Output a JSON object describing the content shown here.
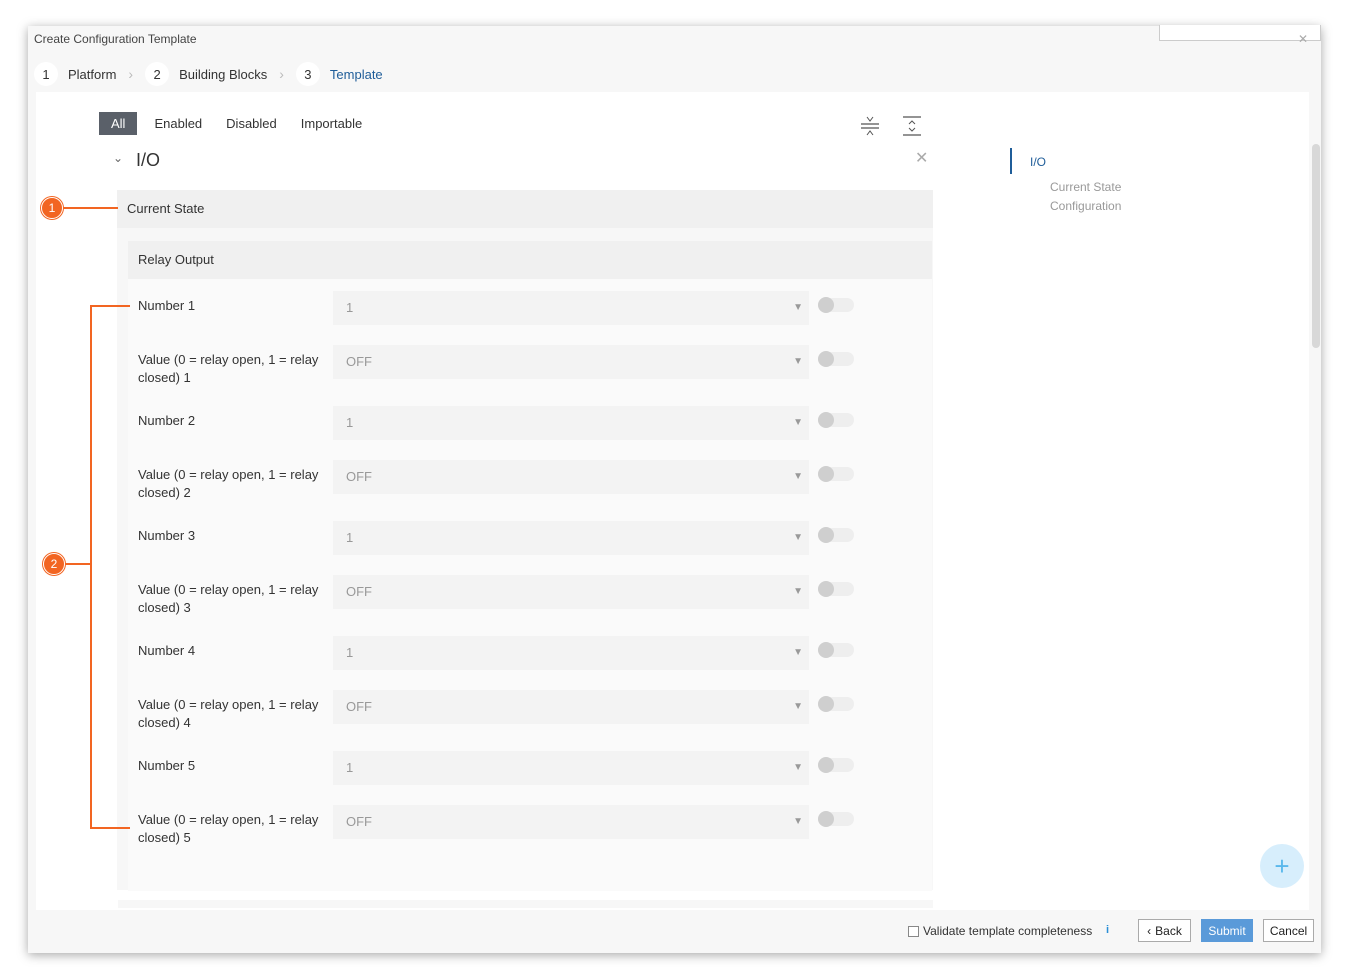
{
  "window": {
    "title": "Create Configuration Template"
  },
  "steps": [
    {
      "num": "1",
      "label": "Platform"
    },
    {
      "num": "2",
      "label": "Building Blocks"
    },
    {
      "num": "3",
      "label": "Template"
    }
  ],
  "filters": {
    "all": "All",
    "enabled": "Enabled",
    "disabled": "Disabled",
    "importable": "Importable"
  },
  "card": {
    "title": "I/O",
    "section": "Current State",
    "subsection": "Relay Output",
    "rows": [
      {
        "label": "Number 1",
        "value": "1"
      },
      {
        "label": "Value (0 = relay open, 1 = relay closed) 1",
        "value": "OFF"
      },
      {
        "label": "Number 2",
        "value": "1"
      },
      {
        "label": "Value (0 = relay open, 1 = relay closed) 2",
        "value": "OFF"
      },
      {
        "label": "Number 3",
        "value": "1"
      },
      {
        "label": "Value (0 = relay open, 1 = relay closed) 3",
        "value": "OFF"
      },
      {
        "label": "Number 4",
        "value": "1"
      },
      {
        "label": "Value (0 = relay open, 1 = relay closed) 4",
        "value": "OFF"
      },
      {
        "label": "Number 5",
        "value": "1"
      },
      {
        "label": "Value (0 = relay open, 1 = relay closed) 5",
        "value": "OFF"
      }
    ]
  },
  "nav": {
    "active": "I/O",
    "sub1": "Current State",
    "sub2": "Configuration"
  },
  "footer": {
    "validate": "Validate template completeness",
    "back": "Back",
    "submit": "Submit",
    "cancel": "Cancel"
  },
  "callouts": {
    "one": "1",
    "two": "2"
  },
  "colors": {
    "accent": "#1f5d99",
    "callout": "#f26522",
    "primary_button": "#5a9ad9"
  }
}
